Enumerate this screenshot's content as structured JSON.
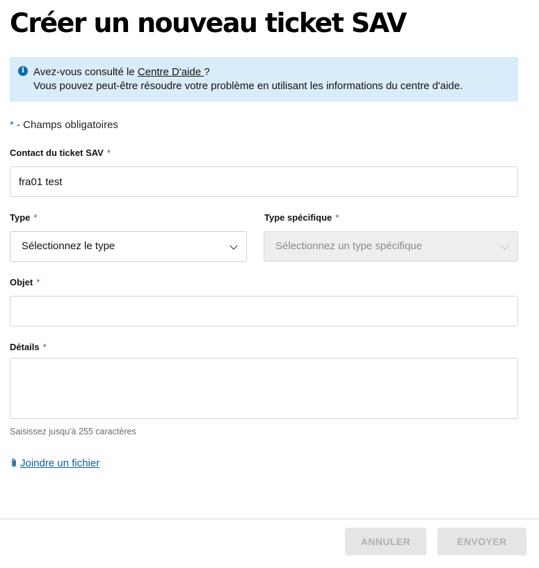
{
  "page": {
    "title": "Créer un nouveau ticket SAV"
  },
  "info": {
    "line1_prefix": "Avez-vous consulté le ",
    "link_label": "Centre D'aide ",
    "line1_suffix": "?",
    "line2": "Vous pouvez peut-être résoudre votre problème en utilisant les informations du centre d'aide.",
    "icon": "info-icon",
    "icon_glyph": "i"
  },
  "legend": {
    "asterisk": "*",
    "text": " - Champs obligatoires"
  },
  "fields": {
    "required_mark": "*",
    "contact": {
      "label": "Contact du ticket SAV",
      "value": "fra01 test"
    },
    "type": {
      "label": "Type",
      "selected": "Sélectionnez le type"
    },
    "specific_type": {
      "label": "Type spécifique",
      "selected": "Sélectionnez un type spécifique",
      "disabled": true
    },
    "subject": {
      "label": "Objet",
      "value": ""
    },
    "details": {
      "label": "Détails",
      "value": "",
      "helper": "Saisissez jusqu'à 255 caractères"
    }
  },
  "attachment": {
    "label": "Joindre un fichier",
    "icon": "paperclip-icon"
  },
  "actions": {
    "cancel_label": "ANNULER",
    "submit_label": "ENVOYER"
  },
  "colors": {
    "accent": "#0b6db0",
    "info_background": "#d8ecf9",
    "disabled_button": "#e5e5e5",
    "disabled_text": "#b0b0b0"
  }
}
